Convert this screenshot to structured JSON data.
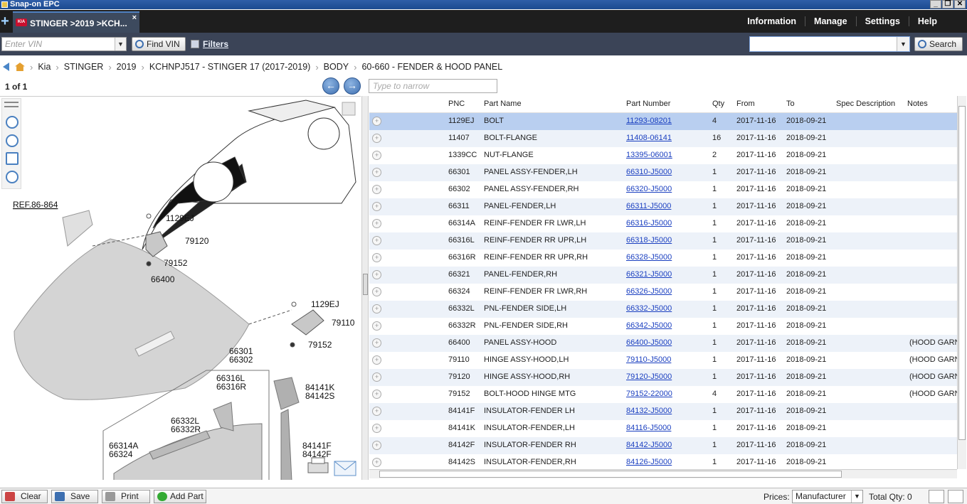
{
  "window": {
    "title": "Snap-on EPC"
  },
  "tab": {
    "label": "STINGER >2019 >KCH...",
    "close": "×",
    "new": "+"
  },
  "topmenu": [
    "Information",
    "Manage",
    "Settings",
    "Help"
  ],
  "toolbar": {
    "vin_placeholder": "Enter VIN",
    "find_vin": "Find VIN",
    "filters": "Filters",
    "search_value": "",
    "search": "Search"
  },
  "breadcrumb": [
    "Kia",
    "STINGER",
    "2019",
    "KCHNPJ517 - STINGER 17 (2017-2019)",
    "BODY",
    "60-660 - FENDER & HOOD PANEL"
  ],
  "pager": {
    "label": "1 of 1"
  },
  "narrow_placeholder": "Type to narrow",
  "columns": {
    "pnc": "PNC",
    "name": "Part Name",
    "number": "Part Number",
    "qty": "Qty",
    "from": "From",
    "to": "To",
    "spec": "Spec Description",
    "notes": "Notes"
  },
  "rows": [
    {
      "pnc": "1129EJ",
      "name": "BOLT",
      "number": "11293-08201",
      "qty": "4",
      "from": "2017-11-16",
      "to": "2018-09-21",
      "notes": ""
    },
    {
      "pnc": "11407",
      "name": "BOLT-FLANGE",
      "number": "11408-06141",
      "qty": "16",
      "from": "2017-11-16",
      "to": "2018-09-21",
      "notes": ""
    },
    {
      "pnc": "1339CC",
      "name": "NUT-FLANGE",
      "number": "13395-06001",
      "qty": "2",
      "from": "2017-11-16",
      "to": "2018-09-21",
      "notes": ""
    },
    {
      "pnc": "66301",
      "name": "PANEL ASSY-FENDER,LH",
      "number": "66310-J5000",
      "qty": "1",
      "from": "2017-11-16",
      "to": "2018-09-21",
      "notes": ""
    },
    {
      "pnc": "66302",
      "name": "PANEL ASSY-FENDER,RH",
      "number": "66320-J5000",
      "qty": "1",
      "from": "2017-11-16",
      "to": "2018-09-21",
      "notes": ""
    },
    {
      "pnc": "66311",
      "name": "PANEL-FENDER,LH",
      "number": "66311-J5000",
      "qty": "1",
      "from": "2017-11-16",
      "to": "2018-09-21",
      "notes": ""
    },
    {
      "pnc": "66314A",
      "name": "REINF-FENDER FR LWR,LH",
      "number": "66316-J5000",
      "qty": "1",
      "from": "2017-11-16",
      "to": "2018-09-21",
      "notes": ""
    },
    {
      "pnc": "66316L",
      "name": "REINF-FENDER RR UPR,LH",
      "number": "66318-J5000",
      "qty": "1",
      "from": "2017-11-16",
      "to": "2018-09-21",
      "notes": ""
    },
    {
      "pnc": "66316R",
      "name": "REINF-FENDER RR UPR,RH",
      "number": "66328-J5000",
      "qty": "1",
      "from": "2017-11-16",
      "to": "2018-09-21",
      "notes": ""
    },
    {
      "pnc": "66321",
      "name": "PANEL-FENDER,RH",
      "number": "66321-J5000",
      "qty": "1",
      "from": "2017-11-16",
      "to": "2018-09-21",
      "notes": ""
    },
    {
      "pnc": "66324",
      "name": "REINF-FENDER FR LWR,RH",
      "number": "66326-J5000",
      "qty": "1",
      "from": "2017-11-16",
      "to": "2018-09-21",
      "notes": ""
    },
    {
      "pnc": "66332L",
      "name": "PNL-FENDER SIDE,LH",
      "number": "66332-J5000",
      "qty": "1",
      "from": "2017-11-16",
      "to": "2018-09-21",
      "notes": ""
    },
    {
      "pnc": "66332R",
      "name": "PNL-FENDER SIDE,RH",
      "number": "66342-J5000",
      "qty": "1",
      "from": "2017-11-16",
      "to": "2018-09-21",
      "notes": ""
    },
    {
      "pnc": "66400",
      "name": "PANEL ASSY-HOOD",
      "number": "66400-J5000",
      "qty": "1",
      "from": "2017-11-16",
      "to": "2018-09-21",
      "notes": "(HOOD GARN"
    },
    {
      "pnc": "79110",
      "name": "HINGE ASSY-HOOD,LH",
      "number": "79110-J5000",
      "qty": "1",
      "from": "2017-11-16",
      "to": "2018-09-21",
      "notes": "(HOOD GARN"
    },
    {
      "pnc": "79120",
      "name": "HINGE ASSY-HOOD,RH",
      "number": "79120-J5000",
      "qty": "1",
      "from": "2017-11-16",
      "to": "2018-09-21",
      "notes": "(HOOD GARN"
    },
    {
      "pnc": "79152",
      "name": "BOLT-HOOD HINGE MTG",
      "number": "79152-22000",
      "qty": "4",
      "from": "2017-11-16",
      "to": "2018-09-21",
      "notes": "(HOOD GARN"
    },
    {
      "pnc": "84141F",
      "name": "INSULATOR-FENDER LH",
      "number": "84132-J5000",
      "qty": "1",
      "from": "2017-11-16",
      "to": "2018-09-21",
      "notes": ""
    },
    {
      "pnc": "84141K",
      "name": "INSULATOR-FENDER,LH",
      "number": "84116-J5000",
      "qty": "1",
      "from": "2017-11-16",
      "to": "2018-09-21",
      "notes": ""
    },
    {
      "pnc": "84142F",
      "name": "INSULATOR-FENDER RH",
      "number": "84142-J5000",
      "qty": "1",
      "from": "2017-11-16",
      "to": "2018-09-21",
      "notes": ""
    },
    {
      "pnc": "84142S",
      "name": "INSULATOR-FENDER,RH",
      "number": "84126-J5000",
      "qty": "1",
      "from": "2017-11-16",
      "to": "2018-09-21",
      "notes": ""
    }
  ],
  "diagram_labels": {
    "ref": "REF.86-864",
    "a": "1129EJ",
    "b": "79120",
    "c": "79152",
    "d": "66400",
    "e": "1129EJ",
    "f": "79110",
    "g": "79152",
    "h": "66301",
    "i": "66302",
    "j": "66316L",
    "k": "66316R",
    "l": "84141K",
    "m": "84142S",
    "n": "66332L",
    "o": "66332R",
    "p": "66314A",
    "q": "66324",
    "r": "84141F",
    "s": "84142F"
  },
  "bottom": {
    "clear": "Clear",
    "save": "Save",
    "print": "Print",
    "add_part": "Add Part",
    "prices_label": "Prices:",
    "prices_value": "Manufacturer",
    "total_qty": "Total Qty: 0"
  },
  "colors": {
    "selected_row": "#b9cff0",
    "alt_row": "#edf2f9",
    "link": "#1a3fc0",
    "toolbar": "#3b4457",
    "tabbar": "#1e1e1e"
  }
}
